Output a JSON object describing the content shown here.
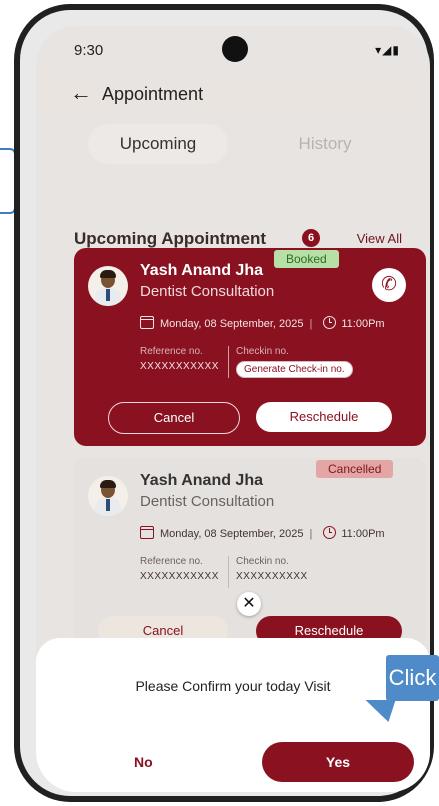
{
  "status_bar": {
    "time": "9:30",
    "icons": "▾◢▮"
  },
  "app_bar": {
    "back_icon": "←",
    "title": "Appointment"
  },
  "tabs": [
    {
      "label": "Upcoming"
    },
    {
      "label": "History"
    }
  ],
  "section": {
    "title": "Upcoming Appointment",
    "count": "6",
    "view_all": "View All"
  },
  "appointments": [
    {
      "status": "Booked",
      "doctor_name": "Yash Anand Jha",
      "consultation": "Dentist Consultation",
      "date": "Monday, 08 September, 2025",
      "time": "11:00Pm",
      "reference_label": "Reference no.",
      "reference_value": "XXXXXXXXXXX",
      "checkin_label": "Checkin no.",
      "checkin_action": "Generate Check-in no.",
      "cancel_label": "Cancel",
      "reschedule_label": "Reschedule"
    },
    {
      "status": "Cancelled",
      "doctor_name": "Yash Anand Jha",
      "consultation": "Dentist Consultation",
      "date": "Monday, 08 September, 2025",
      "time": "11:00Pm",
      "reference_label": "Reference no.",
      "reference_value": "XXXXXXXXXXX",
      "checkin_label": "Checkin no.",
      "checkin_value": "XXXXXXXXXX",
      "cancel_label": "Cancel",
      "reschedule_label": "Reschedule"
    }
  ],
  "close_icon": "✕",
  "confirm_sheet": {
    "message": "Please Confirm your today Visit",
    "no_label": "No",
    "yes_label": "Yes"
  },
  "callout": {
    "text": "Click"
  },
  "colors": {
    "brand": "#8a1220",
    "booked_bg": "#b7e0a6",
    "cancelled_bg": "#e4a5a5",
    "callout": "#4f8bc9"
  }
}
